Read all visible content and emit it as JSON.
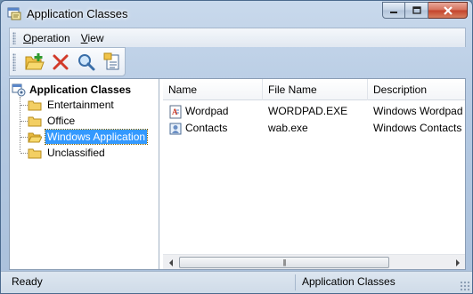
{
  "window": {
    "title": "Application Classes"
  },
  "menubar": {
    "items": [
      {
        "label": "Operation",
        "mnemonic": "O",
        "rest": "peration"
      },
      {
        "label": "View",
        "mnemonic": "V",
        "rest": "iew"
      }
    ]
  },
  "toolbar": {
    "buttons": [
      {
        "icon": "new-folder-icon"
      },
      {
        "icon": "delete-icon"
      },
      {
        "icon": "search-icon"
      },
      {
        "icon": "properties-icon"
      }
    ]
  },
  "tree": {
    "root": "Application Classes",
    "items": [
      "Entertainment",
      "Office",
      "Windows Application",
      "Unclassified"
    ],
    "selected": "Windows Application"
  },
  "list": {
    "columns": [
      "Name",
      "File Name",
      "Description"
    ],
    "rows": [
      {
        "name": "Wordpad",
        "file": "WORDPAD.EXE",
        "description": "Windows Wordpad"
      },
      {
        "name": "Contacts",
        "file": "wab.exe",
        "description": "Windows Contacts"
      }
    ]
  },
  "statusbar": {
    "left": "Ready",
    "right": "Application Classes"
  },
  "colors": {
    "selection": "#3399ff",
    "frame": "#b4c9e2",
    "close": "#c4422b"
  }
}
